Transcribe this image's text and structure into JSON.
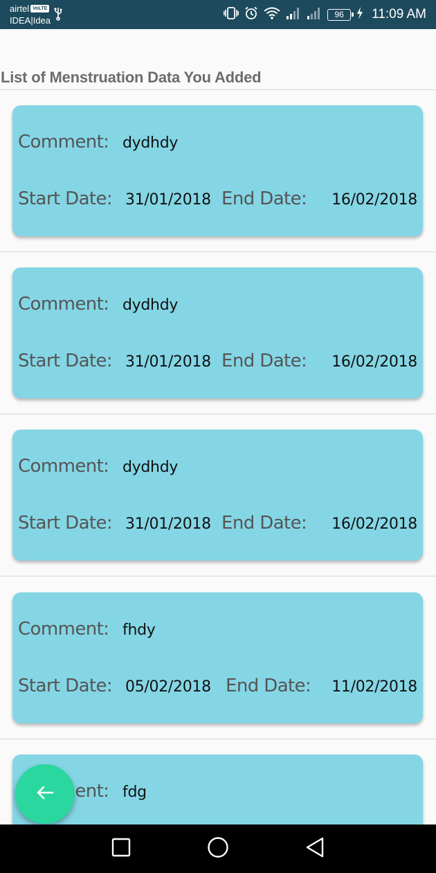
{
  "status_bar": {
    "carrier1": "airtel",
    "volte_badge": "VoLTE",
    "carrier2": "IDEA|Idea",
    "battery": "96",
    "time": "11:09 AM",
    "icons": [
      "usb-icon",
      "vibrate-icon",
      "alarm-icon",
      "wifi-icon",
      "signal-icon",
      "signal-icon",
      "battery-icon",
      "charging-icon"
    ]
  },
  "header": {
    "title": "List of Menstruation Data You Added"
  },
  "labels": {
    "comment": "Comment:",
    "start_date": "Start Date:",
    "end_date": "End Date:"
  },
  "entries": [
    {
      "comment": "dydhdy",
      "start_date": "31/01/2018",
      "end_date": "16/02/2018"
    },
    {
      "comment": "dydhdy",
      "start_date": "31/01/2018",
      "end_date": "16/02/2018"
    },
    {
      "comment": "dydhdy",
      "start_date": "31/01/2018",
      "end_date": "16/02/2018"
    },
    {
      "comment": "fhdy",
      "start_date": "05/02/2018",
      "end_date": "11/02/2018"
    },
    {
      "comment": "fdg"
    }
  ],
  "fab": {
    "icon": "arrow-left-icon"
  },
  "nav": {
    "icons": [
      "recents-square-icon",
      "home-circle-icon",
      "back-triangle-icon"
    ]
  },
  "colors": {
    "status_bar": "#1d4a5c",
    "card": "#84d6e5",
    "fab": "#2ad79f",
    "nav_bar": "#000000"
  }
}
